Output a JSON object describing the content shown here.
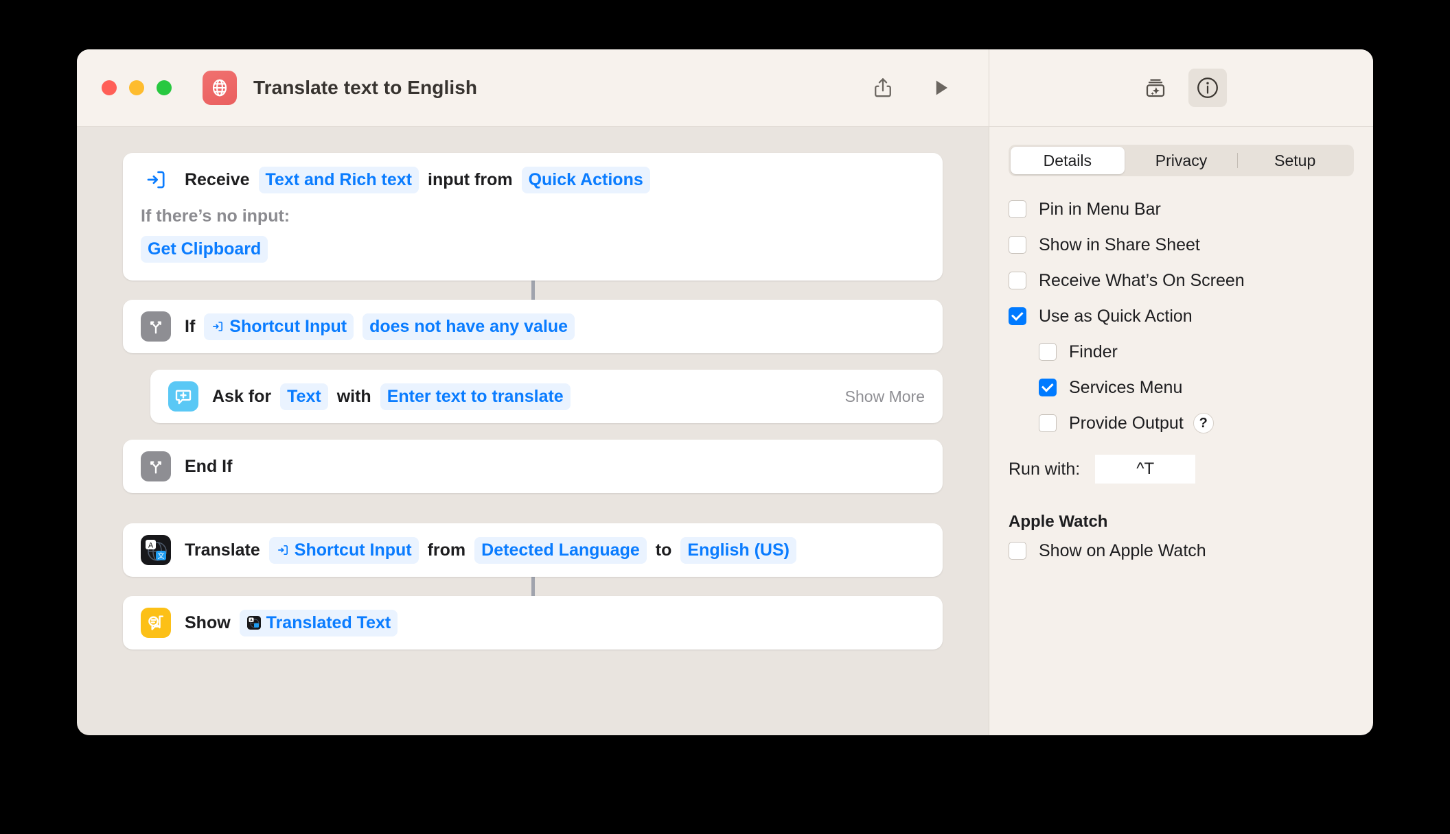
{
  "window": {
    "title": "Translate text to English",
    "app_icon": "globe-icon",
    "traffic_lights": [
      "close",
      "minimize",
      "zoom"
    ],
    "toolbar": {
      "share_label": "share-icon",
      "run_label": "play-icon",
      "add_action_label": "add-action-sparkle-icon",
      "info_label": "info-icon"
    }
  },
  "canvas": {
    "actions": [
      {
        "id": "receive",
        "icon": "receive-input-icon",
        "lead": "Receive",
        "token1": "Text and Rich text",
        "mid": "input from",
        "token2": "Quick Actions",
        "sub_label": "If there’s no input:",
        "sub_token": "Get Clipboard"
      },
      {
        "id": "if",
        "icon": "fork-icon",
        "lead": "If",
        "token1": "Shortcut Input",
        "token2": "does not have any value"
      },
      {
        "id": "ask",
        "icon": "ask-input-icon",
        "lead": "Ask for",
        "token1": "Text",
        "mid": "with",
        "token2": "Enter text to translate",
        "show_more": "Show More"
      },
      {
        "id": "endif",
        "icon": "fork-icon",
        "lead": "End If"
      },
      {
        "id": "translate",
        "icon": "translate-icon",
        "lead": "Translate",
        "token1": "Shortcut Input",
        "mid": "from",
        "token2": "Detected Language",
        "mid2": "to",
        "token3": "English (US)"
      },
      {
        "id": "show",
        "icon": "show-result-icon",
        "lead": "Show",
        "token1": "Translated Text"
      }
    ]
  },
  "sidebar": {
    "tabs": [
      {
        "label": "Details",
        "active": true
      },
      {
        "label": "Privacy",
        "active": false
      },
      {
        "label": "Setup",
        "active": false
      }
    ],
    "checkboxes": [
      {
        "label": "Pin in Menu Bar",
        "checked": false,
        "indent": false
      },
      {
        "label": "Show in Share Sheet",
        "checked": false,
        "indent": false
      },
      {
        "label": "Receive What’s On Screen",
        "checked": false,
        "indent": false
      },
      {
        "label": "Use as Quick Action",
        "checked": true,
        "indent": false
      },
      {
        "label": "Finder",
        "checked": false,
        "indent": true
      },
      {
        "label": "Services Menu",
        "checked": true,
        "indent": true
      },
      {
        "label": "Provide Output",
        "checked": false,
        "indent": true,
        "help": "?"
      }
    ],
    "run_with": {
      "label": "Run with:",
      "value": "^T"
    },
    "apple_watch": {
      "heading": "Apple Watch",
      "checkbox": {
        "label": "Show on Apple Watch",
        "checked": false
      }
    }
  },
  "colors": {
    "accent_blue": "#0a7cff",
    "checkbox_blue": "#007aff",
    "window_chrome": "#f7f2ed",
    "canvas_bg": "#e9e4df",
    "sidebar_bg": "#f5f0eb",
    "app_icon_red": "#ea5f5f"
  }
}
